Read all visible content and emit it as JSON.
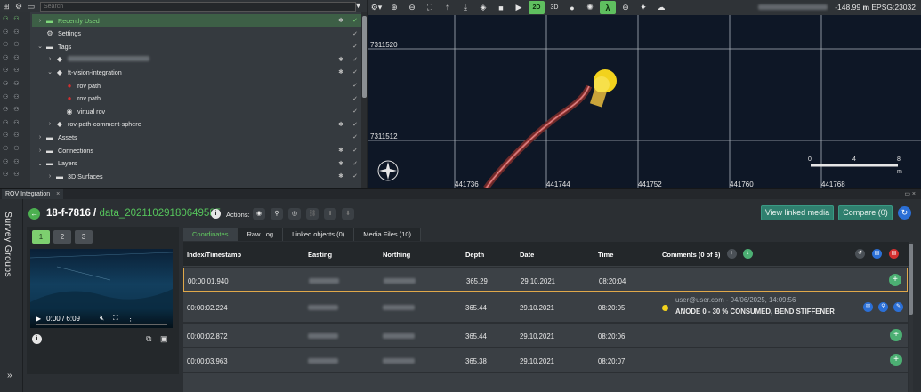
{
  "tree": {
    "search_placeholder": "Search",
    "toolbar_icons": [
      "layers-tree-icon",
      "gear-icon",
      "folder-icon"
    ],
    "rows": [
      {
        "label": "Recently Used",
        "icon": "folder",
        "caret": "›",
        "selected": true,
        "indent": 0
      },
      {
        "label": "Settings",
        "icon": "gear",
        "caret": "",
        "selected": false,
        "indent": 0
      },
      {
        "label": "Tags",
        "icon": "folder",
        "caret": "⌄",
        "selected": false,
        "indent": 0
      },
      {
        "label": "",
        "icon": "tag",
        "caret": "›",
        "selected": false,
        "indent": 1,
        "blurred": true
      },
      {
        "label": "ft-vision-integration",
        "icon": "tag",
        "caret": "⌄",
        "selected": false,
        "indent": 1
      },
      {
        "label": "rov path",
        "icon": "path-red",
        "caret": "",
        "selected": false,
        "indent": 2
      },
      {
        "label": "rov path",
        "icon": "path-red",
        "caret": "",
        "selected": false,
        "indent": 2
      },
      {
        "label": "virtual rov",
        "icon": "rov",
        "caret": "",
        "selected": false,
        "indent": 2
      },
      {
        "label": "rov-path-comment-sphere",
        "icon": "tag",
        "caret": "›",
        "selected": false,
        "indent": 1
      },
      {
        "label": "Assets",
        "icon": "folder",
        "caret": "›",
        "selected": false,
        "indent": 0
      },
      {
        "label": "Connections",
        "icon": "folder",
        "caret": "›",
        "selected": false,
        "indent": 0
      },
      {
        "label": "Layers",
        "icon": "folder",
        "caret": "⌄",
        "selected": false,
        "indent": 0
      },
      {
        "label": "3D Surfaces",
        "icon": "folder",
        "caret": "›",
        "selected": false,
        "indent": 1
      }
    ]
  },
  "map": {
    "toolbar": [
      "settings-dropdown",
      "zoom-in",
      "zoom-out",
      "fit-extent",
      "raise",
      "lower",
      "layers",
      "camera",
      "play",
      "2D",
      "3D",
      "light-1",
      "light-2",
      "lambda",
      "record",
      "sparkle",
      "weather"
    ],
    "mode_2d": "2D",
    "mode_3d": "3D",
    "lambda": "λ",
    "coord_blur": "",
    "depth_value": "-148.99",
    "depth_unit": "m",
    "epsg": "EPSG:23032",
    "y_labels": [
      "7311520",
      "7311512"
    ],
    "x_labels": [
      "441736",
      "441744",
      "441752",
      "441760",
      "441768"
    ],
    "scale_labels": [
      "0",
      "4",
      "8"
    ],
    "scale_unit": "m"
  },
  "panel": {
    "tab_label": "ROV Integration",
    "close": "×"
  },
  "survey": {
    "label": "Survey Groups",
    "expand": "»"
  },
  "header": {
    "dataset_id": "18-f-7816 /",
    "dataset_name": "data_20211029180649585",
    "actions_label": "Actions:",
    "linked_media_button": "View linked media",
    "compare_button": "Compare (0)"
  },
  "video": {
    "tabs": [
      "1",
      "2",
      "3"
    ],
    "time": "0:00 / 6:09"
  },
  "tabs": [
    "Coordinates",
    "Raw Log",
    "Linked objects (0)",
    "Media Files (10)"
  ],
  "table": {
    "columns": [
      "Index/Timestamp",
      "Easting",
      "Northing",
      "Depth",
      "Date",
      "Time",
      "Comments (0 of 6)"
    ],
    "rows": [
      {
        "ts": "00:00:01.940",
        "depth": "365.29",
        "date": "29.10.2021",
        "time": "08:20:04",
        "comment": null,
        "highlight": true
      },
      {
        "ts": "00:00:02.224",
        "depth": "365.44",
        "date": "29.10.2021",
        "time": "08:20:05",
        "comment": {
          "meta": "user@user.com - 04/06/2025, 14:09:56",
          "text": "ANODE 0 - 30 % CONSUMED, BEND STIFFENER"
        },
        "highlight": false
      },
      {
        "ts": "00:00:02.872",
        "depth": "365.44",
        "date": "29.10.2021",
        "time": "08:20:06",
        "comment": null,
        "highlight": false
      },
      {
        "ts": "00:00:03.963",
        "depth": "365.38",
        "date": "29.10.2021",
        "time": "08:20:07",
        "comment": null,
        "highlight": false
      }
    ]
  },
  "colors": {
    "accent": "#4caf50",
    "highlight": "#e0a84a",
    "blue": "#2b6fd6",
    "teal": "#2f7f6e",
    "map_bg": "#0e1726",
    "red": "#d32f2f"
  }
}
